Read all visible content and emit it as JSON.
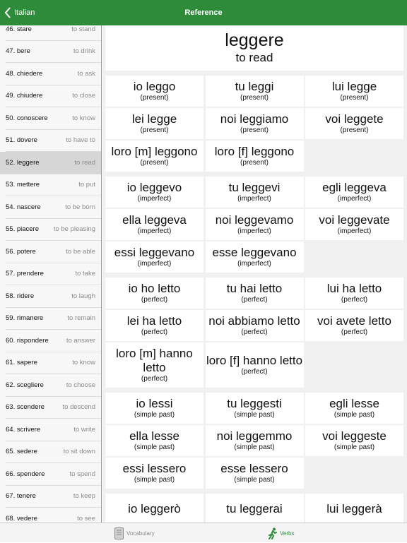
{
  "nav": {
    "back_label": "Italian",
    "title": "Reference"
  },
  "colors": {
    "accent": "#2e8b3a",
    "background": "#f0f0f0"
  },
  "sidebar": {
    "selected_index": 6,
    "items": [
      {
        "word": "46. stare",
        "translation": "to stand"
      },
      {
        "word": "47. bere",
        "translation": "to drink"
      },
      {
        "word": "48. chiedere",
        "translation": "to ask"
      },
      {
        "word": "49. chiudere",
        "translation": "to close"
      },
      {
        "word": "50. conoscere",
        "translation": "to know"
      },
      {
        "word": "51. dovere",
        "translation": "to have to"
      },
      {
        "word": "52. leggere",
        "translation": "to read"
      },
      {
        "word": "53. mettere",
        "translation": "to put"
      },
      {
        "word": "54. nascere",
        "translation": "to be born"
      },
      {
        "word": "55. piacere",
        "translation": "to be pleasing"
      },
      {
        "word": "56. potere",
        "translation": "to be able"
      },
      {
        "word": "57. prendere",
        "translation": "to take"
      },
      {
        "word": "58. ridere",
        "translation": "to laugh"
      },
      {
        "word": "59. rimanere",
        "translation": "to remain"
      },
      {
        "word": "60. rispondere",
        "translation": "to answer"
      },
      {
        "word": "61. sapere",
        "translation": "to know"
      },
      {
        "word": "62. scegliere",
        "translation": "to choose"
      },
      {
        "word": "63. scendere",
        "translation": "to descend"
      },
      {
        "word": "64. scrivere",
        "translation": "to write"
      },
      {
        "word": "65. sedere",
        "translation": "to sit down"
      },
      {
        "word": "66. spendere",
        "translation": "to spend"
      },
      {
        "word": "67. tenere",
        "translation": "to keep"
      },
      {
        "word": "68. vedere",
        "translation": "to see"
      }
    ]
  },
  "header": {
    "verb": "leggere",
    "meaning": "to read"
  },
  "groups": [
    {
      "cells": [
        {
          "form": "io leggo",
          "tense": "(present)"
        },
        {
          "form": "tu leggi",
          "tense": "(present)"
        },
        {
          "form": "lui legge",
          "tense": "(present)"
        },
        {
          "form": "lei legge",
          "tense": "(present)"
        },
        {
          "form": "noi leggiamo",
          "tense": "(present)"
        },
        {
          "form": "voi leggete",
          "tense": "(present)"
        },
        {
          "form": "loro [m] leggono",
          "tense": "(present)"
        },
        {
          "form": "loro [f] leggono",
          "tense": "(present)"
        }
      ]
    },
    {
      "cells": [
        {
          "form": "io leggevo",
          "tense": "(imperfect)"
        },
        {
          "form": "tu leggevi",
          "tense": "(imperfect)"
        },
        {
          "form": "egli leggeva",
          "tense": "(imperfect)"
        },
        {
          "form": "ella leggeva",
          "tense": "(imperfect)"
        },
        {
          "form": "noi leggevamo",
          "tense": "(imperfect)"
        },
        {
          "form": "voi leggevate",
          "tense": "(imperfect)"
        },
        {
          "form": "essi leggevano",
          "tense": "(imperfect)"
        },
        {
          "form": "esse leggevano",
          "tense": "(imperfect)"
        }
      ]
    },
    {
      "cells": [
        {
          "form": "io ho letto",
          "tense": "(perfect)"
        },
        {
          "form": "tu hai letto",
          "tense": "(perfect)"
        },
        {
          "form": "lui ha letto",
          "tense": "(perfect)"
        },
        {
          "form": "lei ha letto",
          "tense": "(perfect)"
        },
        {
          "form": "noi abbiamo letto",
          "tense": "(perfect)"
        },
        {
          "form": "voi avete letto",
          "tense": "(perfect)"
        },
        {
          "form": "loro [m] hanno letto",
          "tense": "(perfect)"
        },
        {
          "form": "loro [f] hanno letto",
          "tense": "(perfect)"
        }
      ]
    },
    {
      "cells": [
        {
          "form": "io lessi",
          "tense": "(simple past)"
        },
        {
          "form": "tu leggesti",
          "tense": "(simple past)"
        },
        {
          "form": "egli lesse",
          "tense": "(simple past)"
        },
        {
          "form": "ella lesse",
          "tense": "(simple past)"
        },
        {
          "form": "noi leggemmo",
          "tense": "(simple past)"
        },
        {
          "form": "voi leggeste",
          "tense": "(simple past)"
        },
        {
          "form": "essi lessero",
          "tense": "(simple past)"
        },
        {
          "form": "esse lessero",
          "tense": "(simple past)"
        }
      ]
    },
    {
      "cells": [
        {
          "form": "io leggerò",
          "tense": ""
        },
        {
          "form": "tu leggerai",
          "tense": ""
        },
        {
          "form": "lui leggerà",
          "tense": ""
        }
      ]
    }
  ],
  "tabbar": {
    "vocab_label": "Vocabulary",
    "vocab_icon": "book-icon",
    "verbs_label": "Verbs",
    "verbs_icon": "running-figure-icon"
  }
}
